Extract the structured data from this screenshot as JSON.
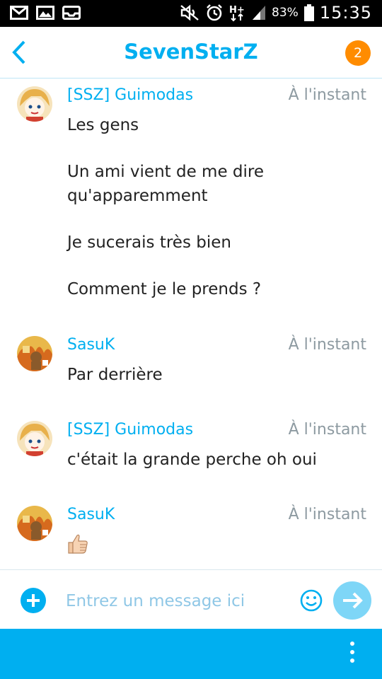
{
  "status_bar": {
    "battery": "83%",
    "time": "15:35"
  },
  "header": {
    "title": "SevenStarZ",
    "badge_count": "2"
  },
  "messages": [
    {
      "author": "[SSZ] Guimodas",
      "time": "À l'instant",
      "avatar": "anime-avatar",
      "lines": [
        "Les gens",
        "Un ami vient de me dire",
        "qu'apparemment",
        "Je sucerais très bien",
        "Comment je le prends ?"
      ]
    },
    {
      "author": "SasuK",
      "time": "À l'instant",
      "avatar": "dog-fire-avatar",
      "lines": [
        "Par derrière"
      ]
    },
    {
      "author": "[SSZ] Guimodas",
      "time": "À l'instant",
      "avatar": "anime-avatar",
      "lines": [
        "c'était la grande perche oh oui"
      ]
    },
    {
      "author": "SasuK",
      "time": "À l'instant",
      "avatar": "dog-fire-avatar",
      "emoji": "thumbs-up-icon"
    }
  ],
  "composer": {
    "placeholder": "Entrez un message ici",
    "value": ""
  },
  "colors": {
    "accent": "#00aff0",
    "badge": "#ff8c00",
    "time": "#8d9aa1"
  }
}
